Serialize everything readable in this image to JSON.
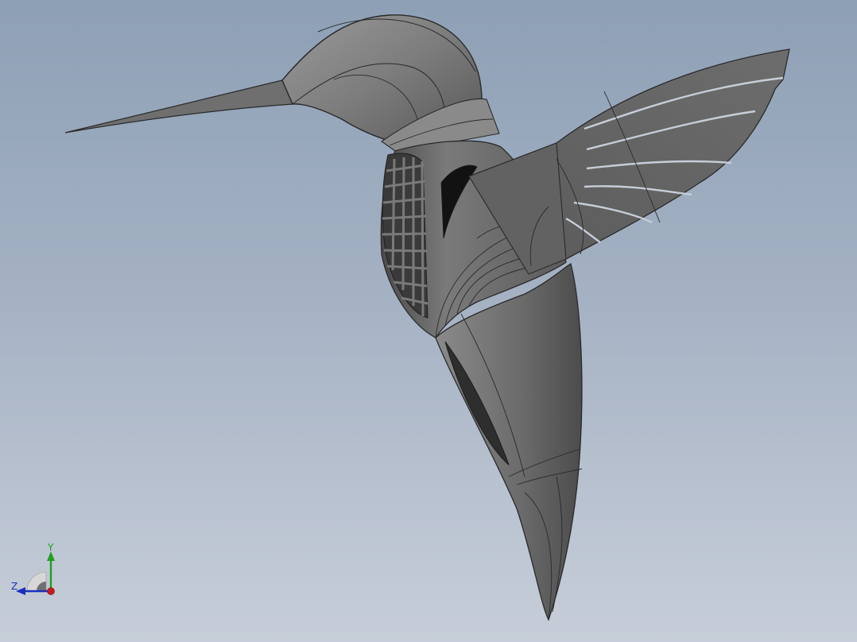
{
  "viewport": {
    "background_top": "#8ea0b6",
    "background_bottom": "#c7ced9"
  },
  "model": {
    "subject": "hummingbird",
    "body_color": "#6e6e6e",
    "edge_color": "#2a2a2a"
  },
  "triad": {
    "y_label": "Y",
    "z_label": "Z",
    "y_color": "#1fa01f",
    "z_color": "#1a2fbf",
    "x_color": "#c41c1c"
  }
}
